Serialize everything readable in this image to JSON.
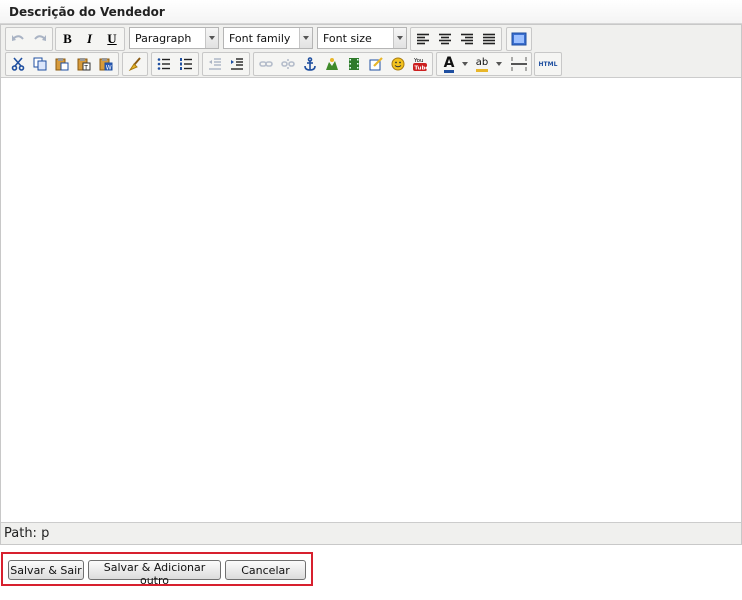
{
  "section": {
    "title": "Descrição do Vendedor"
  },
  "toolbar": {
    "row1": {
      "undo": "undo-icon",
      "redo": "redo-icon",
      "bold": "B",
      "italic": "I",
      "underline": "U",
      "format_select": "Paragraph",
      "font_family_select": "Font family",
      "font_size_select": "Font size",
      "align_left": "align-left-icon",
      "align_center": "align-center-icon",
      "align_right": "align-right-icon",
      "align_justify": "align-justify-icon",
      "fullscreen": "fullscreen-icon"
    },
    "row2": {
      "cut": "scissors-icon",
      "copy": "copy-icon",
      "paste": "paste-icon",
      "paste_text": "paste-text-icon",
      "paste_word": "paste-word-icon",
      "cleanup": "broom-icon",
      "bullet_list": "bullet-list-icon",
      "numbered_list": "numbered-list-icon",
      "outdent": "outdent-icon",
      "indent": "indent-icon",
      "link": "link-icon",
      "unlink": "unlink-icon",
      "anchor": "anchor-icon",
      "image": "image-icon",
      "media": "film-icon",
      "edit": "edit-icon",
      "emoticon": "emoticon-icon",
      "youtube": "You Tube",
      "text_color": "A",
      "highlight": "ab",
      "horizontal_rule": "horizontal-rule-icon",
      "html": "HTML"
    }
  },
  "status": {
    "path": "Path: p"
  },
  "actions": {
    "save_exit": "Salvar & Sair",
    "save_add": "Salvar & Adicionar outro",
    "cancel": "Cancelar"
  },
  "colors": {
    "frame_red": "#d7202e",
    "toolbar_bg": "#f0f0ee",
    "icon_blue": "#1f4fa0",
    "icon_yellow": "#e8b62a",
    "youtube_red": "#cc1f1f"
  }
}
